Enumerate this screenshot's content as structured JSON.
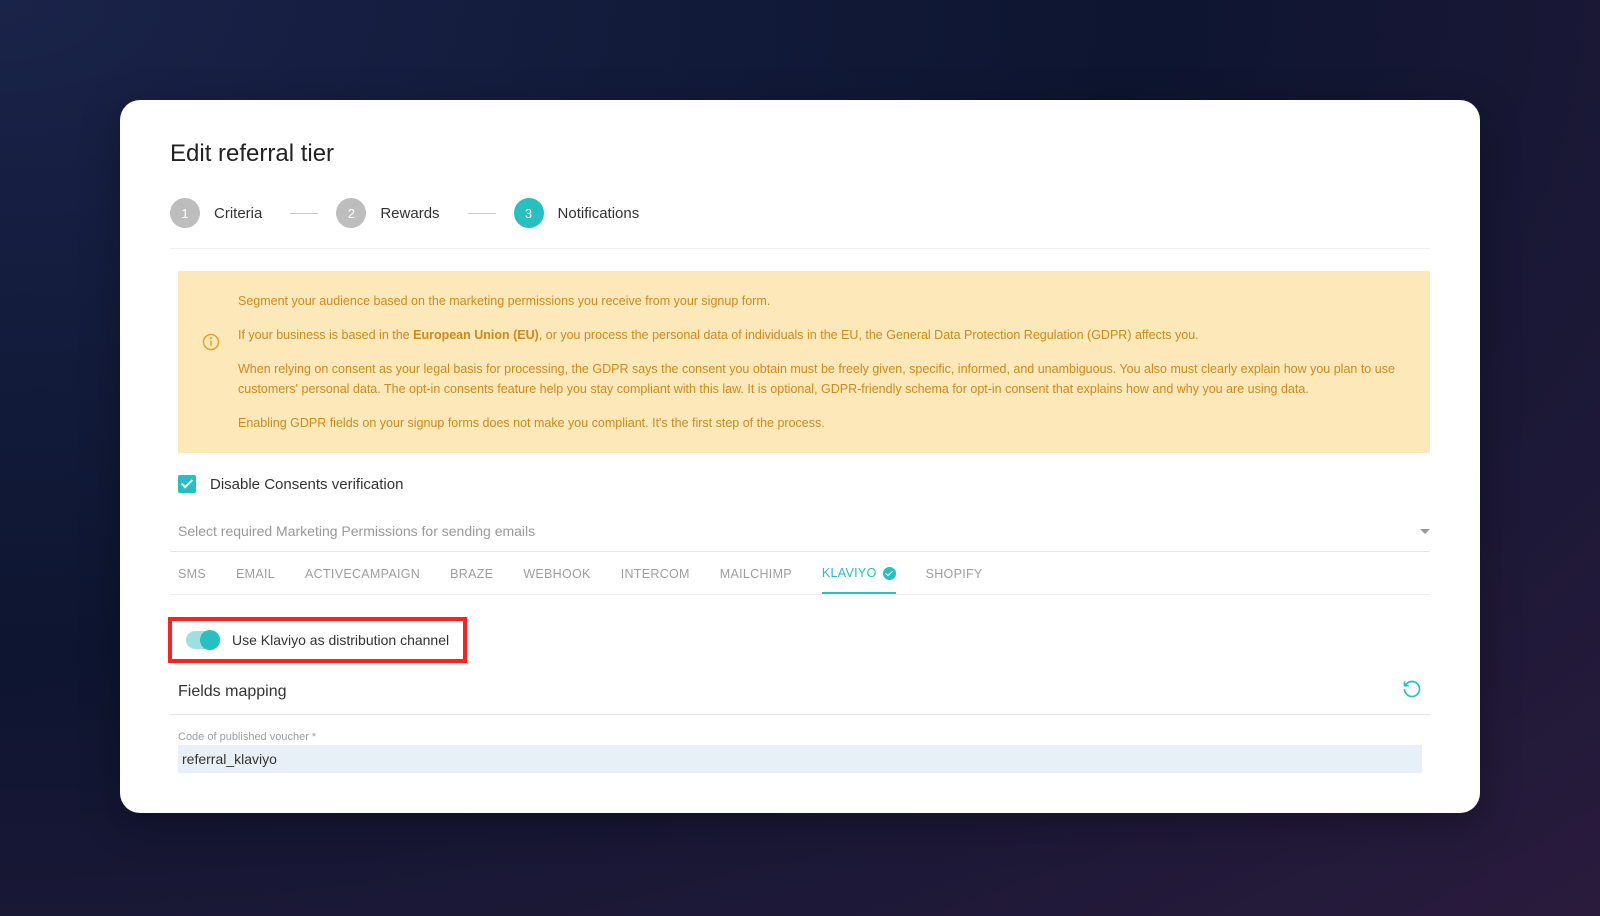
{
  "title": "Edit referral tier",
  "steps": [
    {
      "num": "1",
      "label": "Criteria",
      "active": false
    },
    {
      "num": "2",
      "label": "Rewards",
      "active": false
    },
    {
      "num": "3",
      "label": "Notifications",
      "active": true
    }
  ],
  "alert": {
    "p1": "Segment your audience based on the marketing permissions you receive from your signup form.",
    "p2_pre": "If your business is based in the ",
    "p2_bold": "European Union (EU)",
    "p2_post": ", or you process the personal data of individuals in the EU, the General Data Protection Regulation (GDPR) affects you.",
    "p3": "When relying on consent as your legal basis for processing, the GDPR says the consent you obtain must be freely given, specific, informed, and unambiguous. You also must clearly explain how you plan to use customers' personal data. The opt-in consents feature help you stay compliant with this law. It is optional, GDPR-friendly schema for opt-in consent that explains how and why you are using data.",
    "p4": "Enabling GDPR fields on your signup forms does not make you compliant. It's the first step of the process."
  },
  "disable_consents_label": "Disable Consents verification",
  "permissions_placeholder": "Select required Marketing Permissions for sending emails",
  "tabs": [
    "SMS",
    "EMAIL",
    "ACTIVECAMPAIGN",
    "BRAZE",
    "WEBHOOK",
    "INTERCOM",
    "MAILCHIMP",
    "KLAVIYO",
    "SHOPIFY"
  ],
  "tabs_active_index": 7,
  "toggle_label": "Use Klaviyo as distribution channel",
  "fields_mapping_title": "Fields mapping",
  "field1": {
    "label": "Code of published voucher *",
    "value": "referral_klaviyo"
  }
}
